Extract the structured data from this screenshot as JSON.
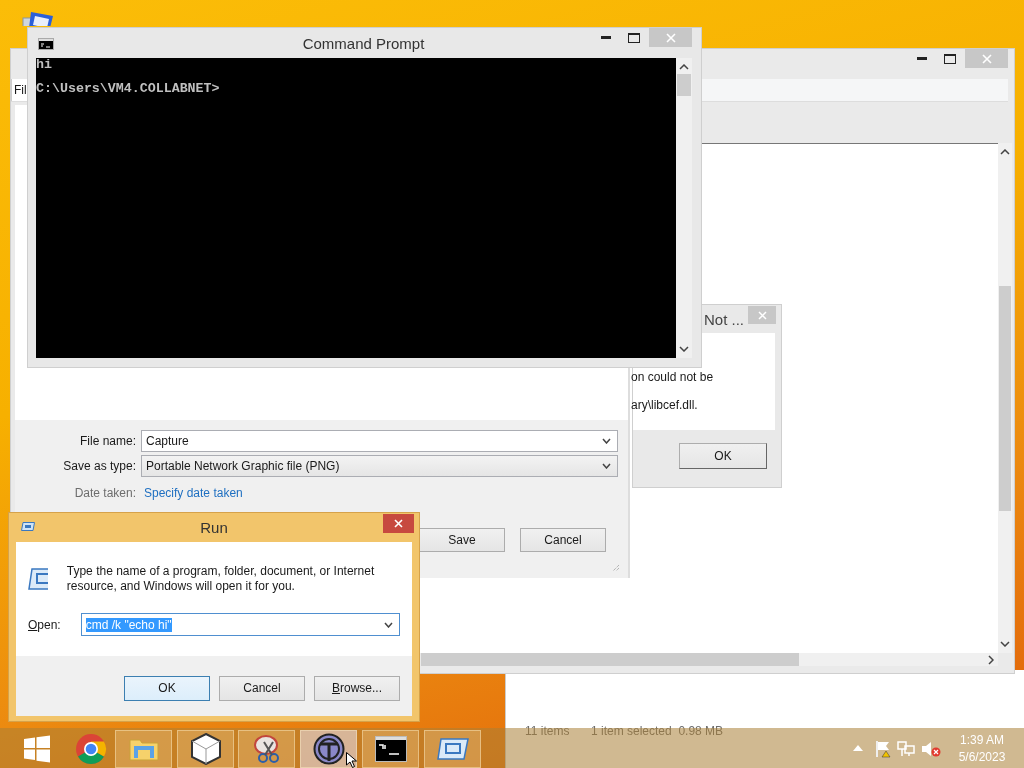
{
  "editor_window": {
    "menu_tab": "Fil"
  },
  "save_dialog": {
    "file_name_label": "File name:",
    "file_name": "Capture",
    "save_type_label": "Save as type:",
    "save_type": "Portable Network Graphic file (PNG)",
    "date_label": "Date taken:",
    "date_link": "Specify date taken",
    "buttons": [
      "Save",
      "Cancel"
    ]
  },
  "error_dialog": {
    "title": "Not ...",
    "lines": [
      "on could not be",
      "ary\\libcef.dll."
    ],
    "button": "OK"
  },
  "command_prompt": {
    "title": "Command Prompt",
    "lines": [
      "hi",
      "C:\\Users\\VM4.COLLABNET>"
    ]
  },
  "explorer_window": {
    "status_items": "11 items",
    "status_selection": "1 item selected  0.98 MB"
  },
  "run_dialog": {
    "title": "Run",
    "message": "Type the name of a program, folder, document, or Internet resource, and Windows will open it for you.",
    "open_label": "Open:",
    "command": "cmd /k \"echo hi\"",
    "text_selected": true,
    "buttons": [
      {
        "label": "OK",
        "focused": true
      },
      {
        "label": "Cancel",
        "focused": false
      },
      {
        "label": "Browse...",
        "focused": false
      }
    ]
  },
  "taskbar": {
    "apps": [
      {
        "kind": "start",
        "running": false,
        "highlighted": false
      },
      {
        "kind": "chrome",
        "running": false,
        "highlighted": false
      },
      {
        "kind": "explorer",
        "running": true,
        "highlighted": false
      },
      {
        "kind": "cube",
        "running": true,
        "highlighted": false
      },
      {
        "kind": "snipping",
        "running": true,
        "highlighted": false
      },
      {
        "kind": "orb",
        "running": true,
        "highlighted": true
      },
      {
        "kind": "cmd",
        "running": true,
        "highlighted": false
      },
      {
        "kind": "run",
        "running": true,
        "highlighted": false
      }
    ],
    "clock": {
      "time": "1:39 AM",
      "date": "5/6/2023"
    }
  }
}
